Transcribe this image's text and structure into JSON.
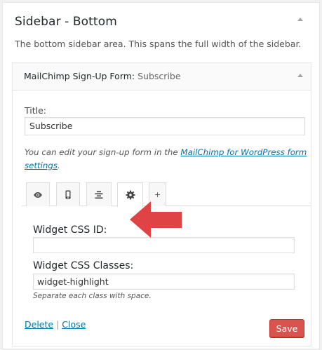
{
  "sidebar": {
    "title": "Sidebar - Bottom",
    "description": "The bottom sidebar area. This spans the full width of the sidebar."
  },
  "widget": {
    "header_title": "MailChimp Sign-Up Form:",
    "header_subtitle": "Subscribe",
    "title_label": "Title:",
    "title_value": "Subscribe",
    "help_prefix": "You can edit your sign-up form in the ",
    "help_link": "MailChimp for WordPress form settings",
    "help_suffix": ".",
    "tabs": [
      {
        "icon": "eye-icon"
      },
      {
        "icon": "mobile-icon"
      },
      {
        "icon": "align-center-icon"
      },
      {
        "icon": "gear-icon",
        "active": true
      },
      {
        "icon": "plus-icon",
        "label": "+"
      }
    ],
    "css_id_label": "Widget CSS ID:",
    "css_id_value": "",
    "css_classes_label": "Widget CSS Classes:",
    "css_classes_value": "widget-highlight",
    "css_classes_help": "Separate each class with space.",
    "delete_label": "Delete",
    "separator": "|",
    "close_label": "Close",
    "save_label": "Save"
  },
  "colors": {
    "link": "#0073aa",
    "save_button": "#d9534f",
    "annotation_arrow": "#e04343"
  }
}
